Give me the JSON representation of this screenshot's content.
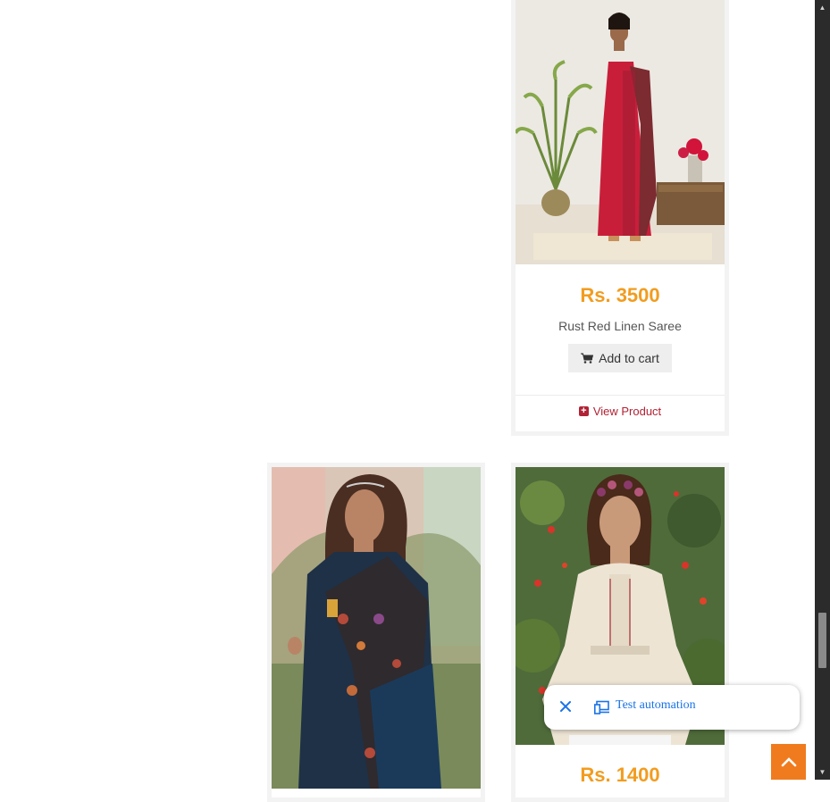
{
  "products": [
    {
      "price": "Rs. 3500",
      "name": "Rust Red Linen Saree",
      "add_to_cart": "Add to cart",
      "view_product": "View Product",
      "image": "woman-in-red-saree-photo"
    },
    {
      "image": "woman-in-navy-floral-saree-photo"
    },
    {
      "price": "Rs. 1400",
      "image": "woman-in-white-top-photo"
    }
  ],
  "toolbar": {
    "label": "Test automation",
    "close_icon": "close-icon",
    "device_icon": "devices-icon"
  },
  "scroll_top_icon": "chevron-up-icon",
  "colors": {
    "price": "#f29c1f",
    "link": "#b12234",
    "scroll_top": "#f07b1e",
    "toolbar_text": "#1a73e8"
  }
}
